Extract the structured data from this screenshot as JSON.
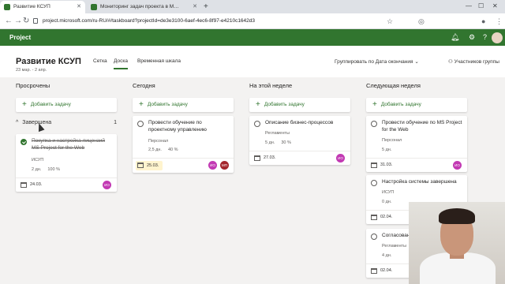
{
  "browser": {
    "tabs": [
      {
        "label": "Развитие КСУП",
        "fav_color": "#31752f"
      },
      {
        "label": "Мониторинг задач проекта в М…",
        "fav_color": "#31752f"
      }
    ],
    "new_tab_glyph": "+",
    "url": "project.microsoft.com/ru-RU/#/taskboard?projectId=de3e3100-6aef-4ec6-8f97-e4210c1642d3"
  },
  "app": {
    "name": "Project",
    "brand_color": "#31752f",
    "icons": [
      "bell-icon",
      "gear-icon",
      "help-icon"
    ]
  },
  "project": {
    "title": "Развитие КСУП",
    "dates": "23 мар. - 2 апр.",
    "views": [
      "Сетка",
      "Доска",
      "Временная шкала"
    ],
    "selected_view": "Доска",
    "group_by": "Группировать по Дата окончания",
    "members_label": "Участников группы"
  },
  "columns": [
    {
      "title": "Просрочены",
      "add_label": "Добавить задачу",
      "completed_label": "Завершена",
      "completed_count": "1",
      "cards": [
        {
          "title": "Покупка и настройка лицензий MS Project for the Web",
          "bucket": "ИСУП",
          "duration": "2 дн.",
          "progress": "100 %",
          "date": "24.03.",
          "done": true,
          "avatars": [
            {
              "initials": "ИО",
              "color": "#c239b3"
            }
          ]
        }
      ]
    },
    {
      "title": "Сегодня",
      "add_label": "Добавить задачу",
      "cards": [
        {
          "title": "Провести обучение по проектному управлению",
          "bucket": "Персонал",
          "duration": "2,5 дн.",
          "progress": "40 %",
          "date": "25.03.",
          "done": false,
          "avatars": [
            {
              "initials": "ИО",
              "color": "#c239b3"
            },
            {
              "initials": "МП",
              "color": "#a4262c"
            }
          ]
        }
      ]
    },
    {
      "title": "На этой неделе",
      "add_label": "Добавить задачу",
      "cards": [
        {
          "title": "Описание бизнес-процессов",
          "bucket": "Регламенты",
          "duration": "5 дн.",
          "progress": "30 %",
          "date": "27.03.",
          "done": false,
          "avatars": [
            {
              "initials": "ИО",
              "color": "#c239b3"
            }
          ]
        }
      ]
    },
    {
      "title": "Следующая неделя",
      "add_label": "Добавить задачу",
      "cards": [
        {
          "title": "Провести обучение по MS Project for the Web",
          "bucket": "Персонал",
          "duration": "5 дн.",
          "progress": "",
          "date": "31.03.",
          "done": false,
          "avatars": [
            {
              "initials": "ИО",
              "color": "#c239b3"
            }
          ]
        },
        {
          "title": "Настройка системы завершена",
          "bucket": "ИСУП",
          "duration": "0 дн.",
          "progress": "",
          "date": "02.04.",
          "done": false,
          "avatars": []
        },
        {
          "title": "Согласован…",
          "bucket": "Регламенты",
          "duration": "4 дн.",
          "progress": "",
          "date": "02.04.",
          "done": false,
          "avatars": []
        }
      ]
    }
  ]
}
